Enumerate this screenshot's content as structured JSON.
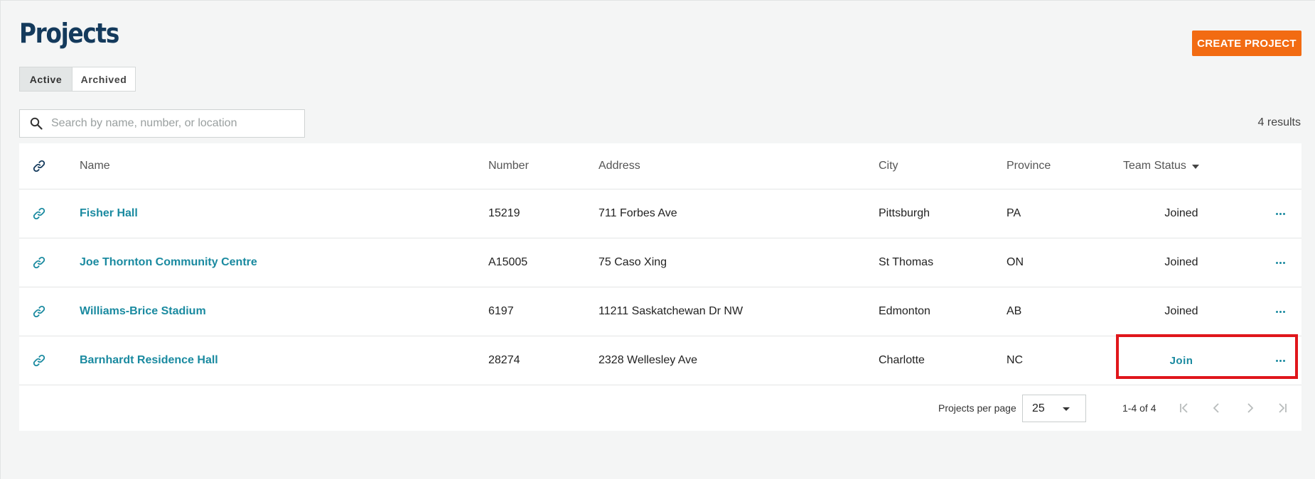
{
  "page": {
    "title": "Projects",
    "create_button_label": "CREATE PROJECT"
  },
  "tabs": [
    {
      "label": "Active",
      "active": true
    },
    {
      "label": "Archived",
      "active": false
    }
  ],
  "search": {
    "placeholder": "Search by name, number, or location",
    "value": ""
  },
  "results_text": "4 results",
  "table": {
    "columns": {
      "name": "Name",
      "number": "Number",
      "address": "Address",
      "city": "City",
      "province": "Province",
      "team_status": "Team Status"
    },
    "rows": [
      {
        "name": "Fisher Hall",
        "number": "15219",
        "address": "711 Forbes Ave",
        "city": "Pittsburgh",
        "province": "PA",
        "status": "Joined"
      },
      {
        "name": "Joe Thornton Community Centre",
        "number": "A15005",
        "address": "75 Caso Xing",
        "city": "St Thomas",
        "province": "ON",
        "status": "Joined"
      },
      {
        "name": "Williams-Brice Stadium",
        "number": "6197",
        "address": "11211 Saskatchewan Dr NW",
        "city": "Edmonton",
        "province": "AB",
        "status": "Joined"
      },
      {
        "name": "Barnhardt Residence Hall",
        "number": "28274",
        "address": "2328 Wellesley Ave",
        "city": "Charlotte",
        "province": "NC",
        "status": "Join"
      }
    ]
  },
  "pagination": {
    "per_page_label": "Projects per page",
    "per_page_value": "25",
    "range_text": "1-4 of 4"
  },
  "icons": {
    "link": "link-icon",
    "search": "search-icon",
    "more": "more-horizontal-icon",
    "first": "first-page-icon",
    "prev": "chevron-left-icon",
    "next": "chevron-right-icon",
    "last": "last-page-icon"
  },
  "colors": {
    "title": "#143a5c",
    "accent": "#f26b12",
    "link": "#1a8aa0",
    "highlight": "#e0161b"
  }
}
